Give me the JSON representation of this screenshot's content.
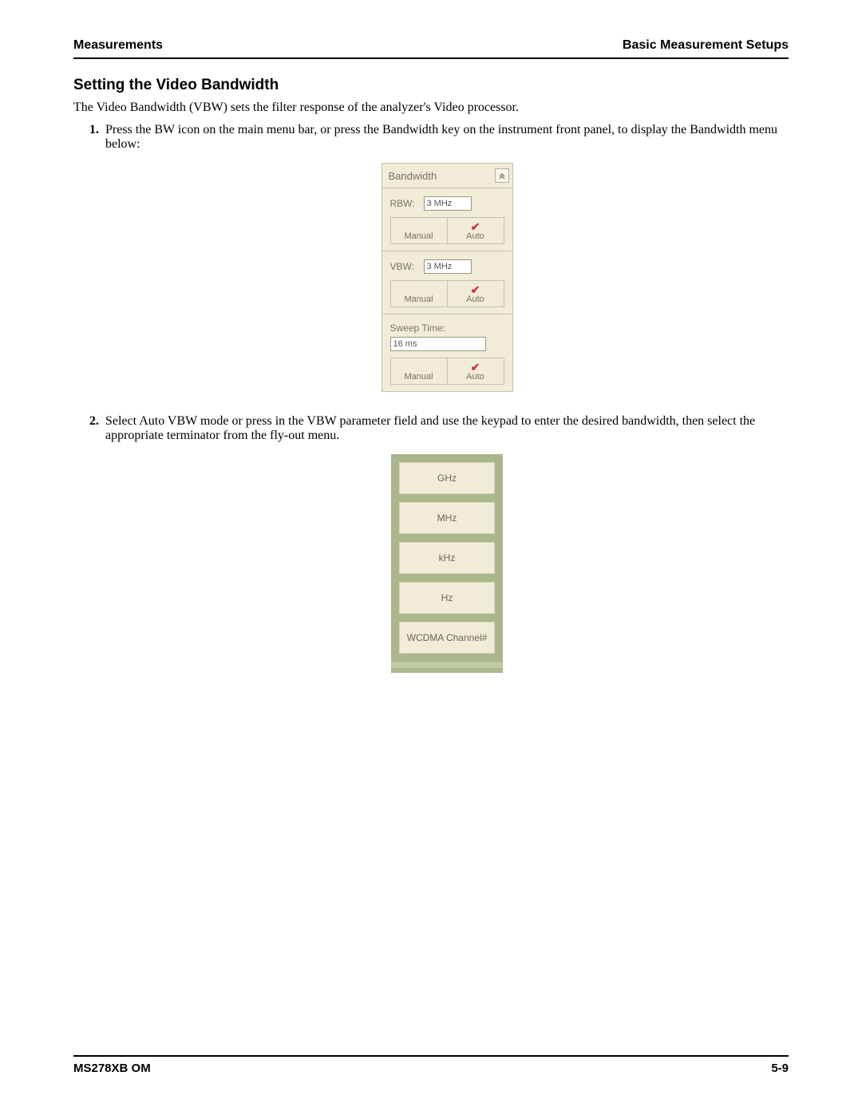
{
  "header": {
    "left": "Measurements",
    "right": "Basic Measurement Setups"
  },
  "section_title": "Setting the Video Bandwidth",
  "intro": "The Video Bandwidth (VBW) sets the filter response of the analyzer's Video processor.",
  "steps": {
    "s1_num": "1.",
    "s1_text": "Press the BW icon on the main menu bar, or press the Bandwidth key on the instrument front panel, to display the Bandwidth menu below:",
    "s2_num": "2.",
    "s2_text": "Select Auto VBW mode or press in the VBW parameter field and use the keypad to enter the desired bandwidth, then select the appropriate terminator from the fly-out menu."
  },
  "bandwidth_panel": {
    "title": "Bandwidth",
    "collapse_glyph": "«",
    "rbw": {
      "label": "RBW:",
      "value": "3 MHz",
      "manual": "Manual",
      "auto": "Auto"
    },
    "vbw": {
      "label": "VBW:",
      "value": "3 MHz",
      "manual": "Manual",
      "auto": "Auto"
    },
    "sweep": {
      "label": "Sweep Time:",
      "value": "16 ms",
      "manual": "Manual",
      "auto": "Auto"
    }
  },
  "flyout": {
    "ghz": "GHz",
    "mhz": "MHz",
    "khz": "kHz",
    "hz": "Hz",
    "wcdma": "WCDMA Channel#"
  },
  "footer": {
    "left": "MS278XB OM",
    "right": "5-9"
  }
}
